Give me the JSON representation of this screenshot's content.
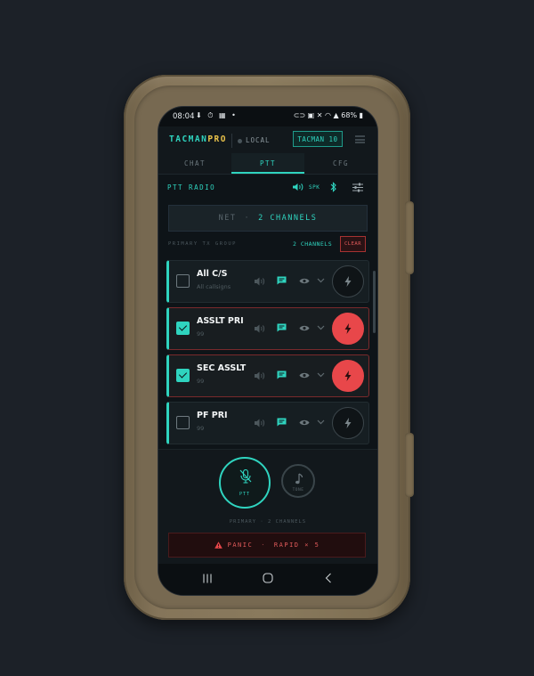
{
  "status_bar": {
    "time": "08:04",
    "left_icons": "⬇ ⏱ ▦ •",
    "right_icons": "⊂⊃ ▣ ✕ ◠ ▲",
    "battery": "68%"
  },
  "header": {
    "brand_part1": "TACMAN",
    "brand_part2": "PRO",
    "network_mode": "LOCAL",
    "callsign": "TACMAN 10"
  },
  "tabs": [
    {
      "label": "CHAT",
      "active": false
    },
    {
      "label": "PTT",
      "active": true
    },
    {
      "label": "CFG",
      "active": false
    }
  ],
  "radio": {
    "title": "PTT RADIO",
    "speaker_label": "SPK"
  },
  "net": {
    "label": "NET",
    "separator": "·",
    "value": "2 CHANNELS"
  },
  "tx_group": {
    "label": "PRIMARY TX GROUP",
    "count": "2 CHANNELS",
    "clear_label": "CLEAR"
  },
  "channels": [
    {
      "name": "All C/S",
      "sub": "All callsigns",
      "checked": false,
      "tx_active": false
    },
    {
      "name": "ASSLT PRI",
      "sub": "99",
      "checked": true,
      "tx_active": true
    },
    {
      "name": "SEC ASSLT",
      "sub": "99",
      "checked": true,
      "tx_active": true
    },
    {
      "name": "PF PRI",
      "sub": "99",
      "checked": false,
      "tx_active": false
    }
  ],
  "controls": {
    "ptt_label": "PTT",
    "tone_label": "TONE",
    "primary_status": "PRIMARY · 2 CHANNELS",
    "panic_label": "PANIC",
    "panic_separator": "·",
    "panic_mode": "RAPID × 5"
  },
  "colors": {
    "accent": "#2fd4bf",
    "brand_gold": "#e9c24a",
    "danger": "#e8474a",
    "background": "#0e1418"
  }
}
